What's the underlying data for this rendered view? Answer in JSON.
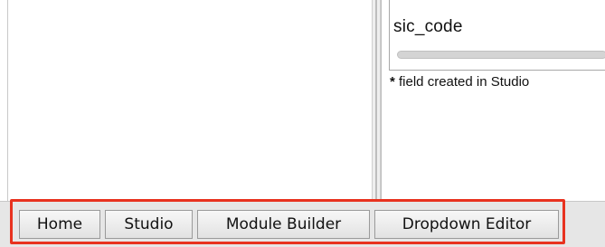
{
  "right_panel": {
    "field_name": "sic_code",
    "note_marker": "*",
    "note_text": " field created in Studio"
  },
  "toolbar": {
    "buttons": [
      {
        "label": "Home"
      },
      {
        "label": "Studio"
      },
      {
        "label": "Module Builder"
      },
      {
        "label": "Dropdown Editor"
      }
    ],
    "highlight_color": "#e8321f"
  }
}
